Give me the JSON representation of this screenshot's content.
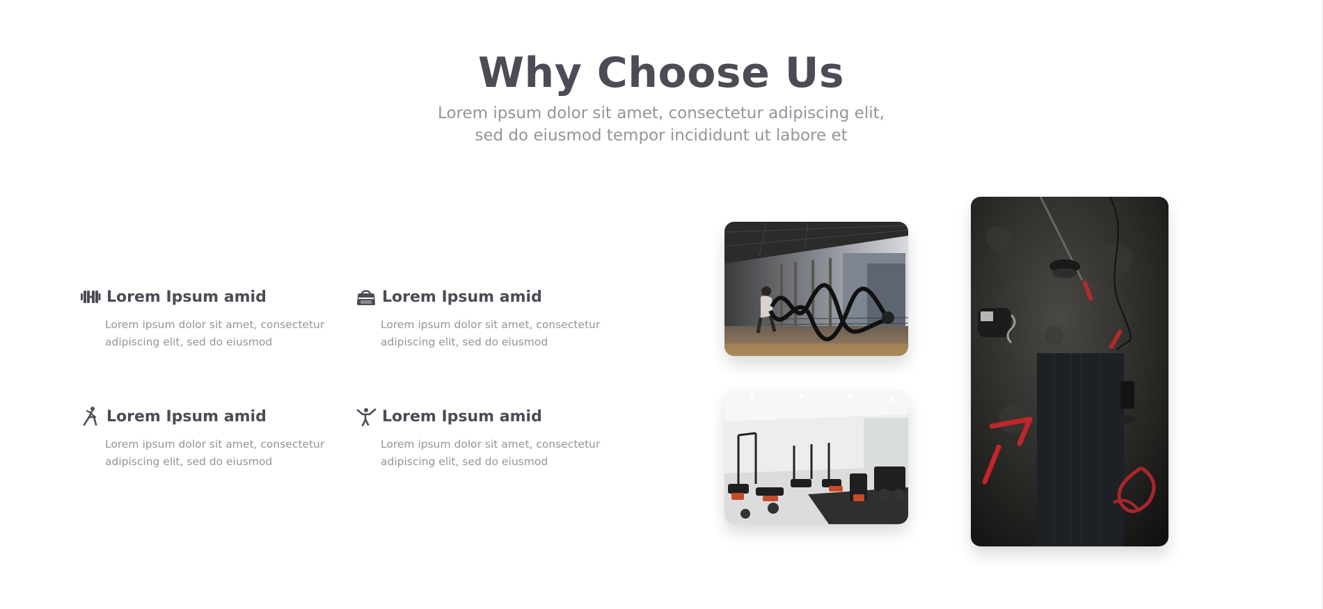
{
  "header": {
    "title": "Why Choose Us",
    "subtitle": "Lorem ipsum dolor sit amet, consectetur adipiscing elit, sed do eiusmod tempor incididunt ut labore et"
  },
  "features": [
    {
      "icon": "dumbbell-icon",
      "title": "Lorem Ipsum amid",
      "text": "Lorem ipsum dolor sit amet, consectetur adipiscing elit, sed do eiusmod"
    },
    {
      "icon": "gym-bag-icon",
      "title": "Lorem Ipsum amid",
      "text": "Lorem ipsum dolor sit amet, consectetur adipiscing elit, sed do eiusmod"
    },
    {
      "icon": "yoga-pose-icon",
      "title": "Lorem Ipsum amid",
      "text": "Lorem ipsum dolor sit amet, consectetur adipiscing elit, sed do eiusmod"
    },
    {
      "icon": "martial-arts-icon",
      "title": "Lorem Ipsum amid",
      "text": "Lorem ipsum dolor sit amet, consectetur adipiscing elit, sed do eiusmod"
    }
  ],
  "gallery": [
    {
      "name": "battle-ropes-photo"
    },
    {
      "name": "gym-interior-photo"
    },
    {
      "name": "gym-equipment-flatlay-photo"
    }
  ],
  "colors": {
    "heading": "#4d4b55",
    "body_text": "#95939b",
    "background": "#ffffff"
  }
}
